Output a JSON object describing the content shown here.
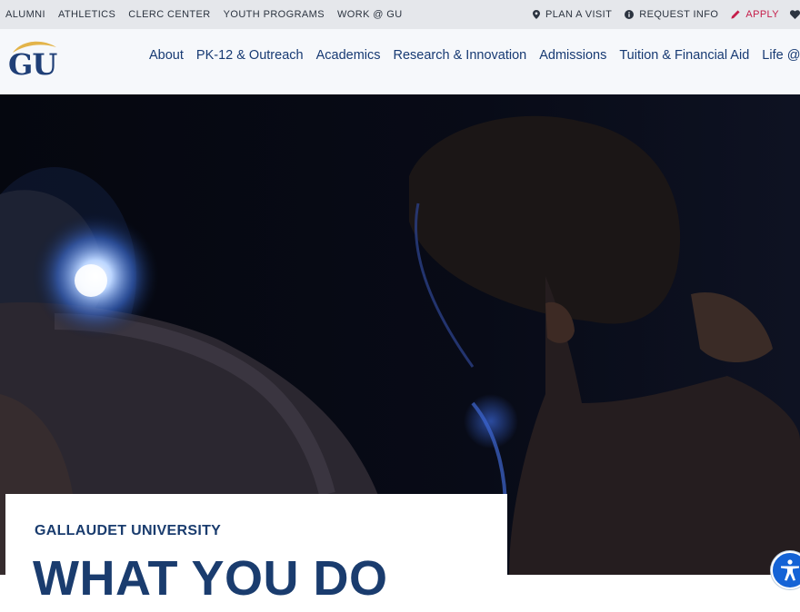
{
  "utility_nav": {
    "left_links": [
      "ALUMNI",
      "ATHLETICS",
      "CLERC CENTER",
      "YOUTH PROGRAMS",
      "WORK @ GU"
    ],
    "plan_visit": "PLAN A VISIT",
    "request_info": "REQUEST INFO",
    "apply": "APPLY"
  },
  "logo": {
    "text": "GU"
  },
  "main_nav": {
    "items": [
      "About",
      "PK-12 & Outreach",
      "Academics",
      "Research & Innovation",
      "Admissions",
      "Tuition & Financial Aid",
      "Life @ GU"
    ]
  },
  "hero": {
    "eyebrow": "GALLAUDET UNIVERSITY",
    "headline": "WHAT YOU DO"
  },
  "colors": {
    "navy": "#1a3c6e",
    "apply_red": "#c51d4a",
    "accessibility_blue": "#1463d6",
    "utility_bar": "#e5e7eb"
  },
  "icons": [
    "map-pin-icon",
    "info-icon",
    "pencil-icon",
    "heart-icon",
    "accessibility-icon"
  ]
}
